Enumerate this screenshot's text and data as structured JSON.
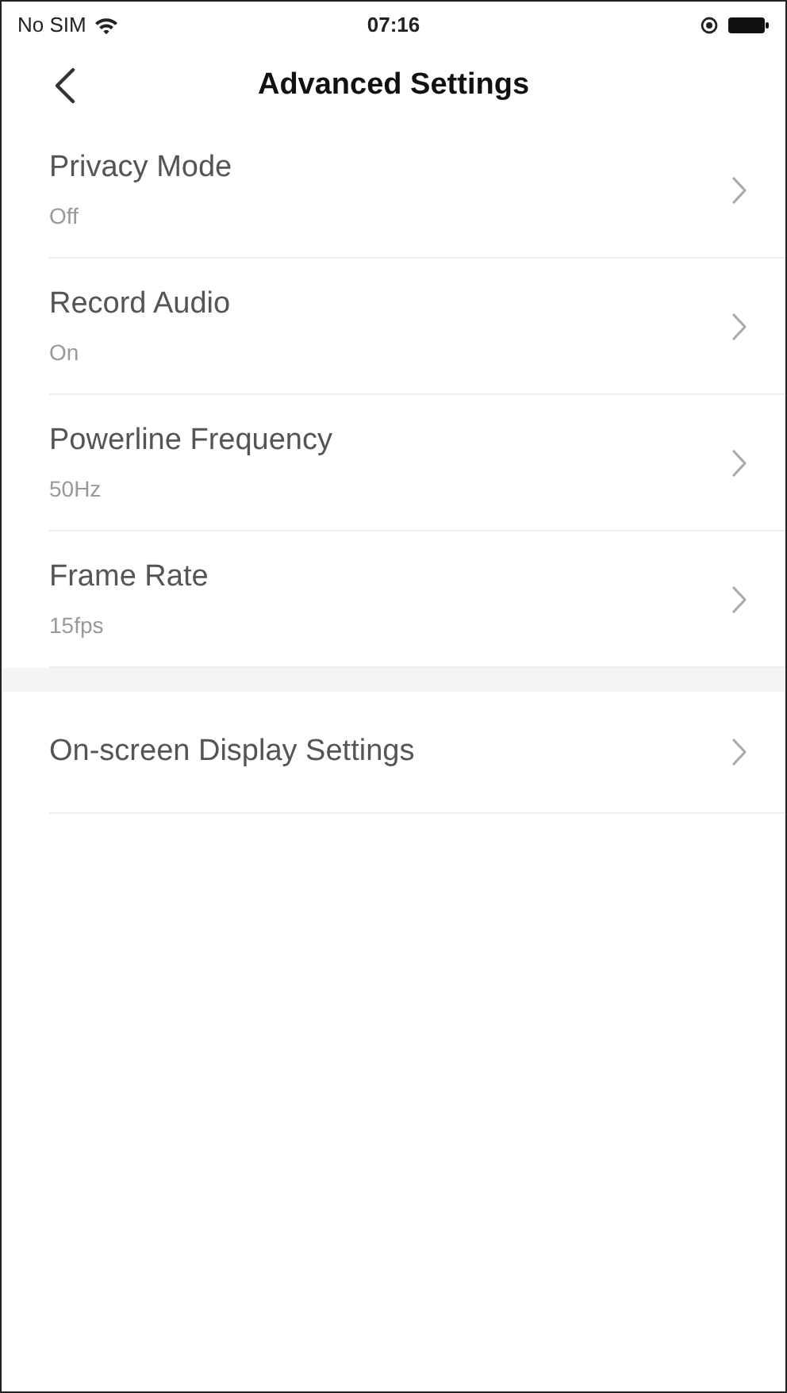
{
  "status_bar": {
    "carrier": "No SIM",
    "time": "07:16"
  },
  "nav_bar": {
    "title": "Advanced Settings"
  },
  "sections": [
    {
      "items": [
        {
          "label": "Privacy Mode",
          "value": "Off"
        },
        {
          "label": "Record Audio",
          "value": "On"
        },
        {
          "label": "Powerline Frequency",
          "value": "50Hz"
        },
        {
          "label": "Frame Rate",
          "value": "15fps"
        }
      ]
    },
    {
      "items": [
        {
          "label": "On-screen Display Settings"
        }
      ]
    }
  ]
}
